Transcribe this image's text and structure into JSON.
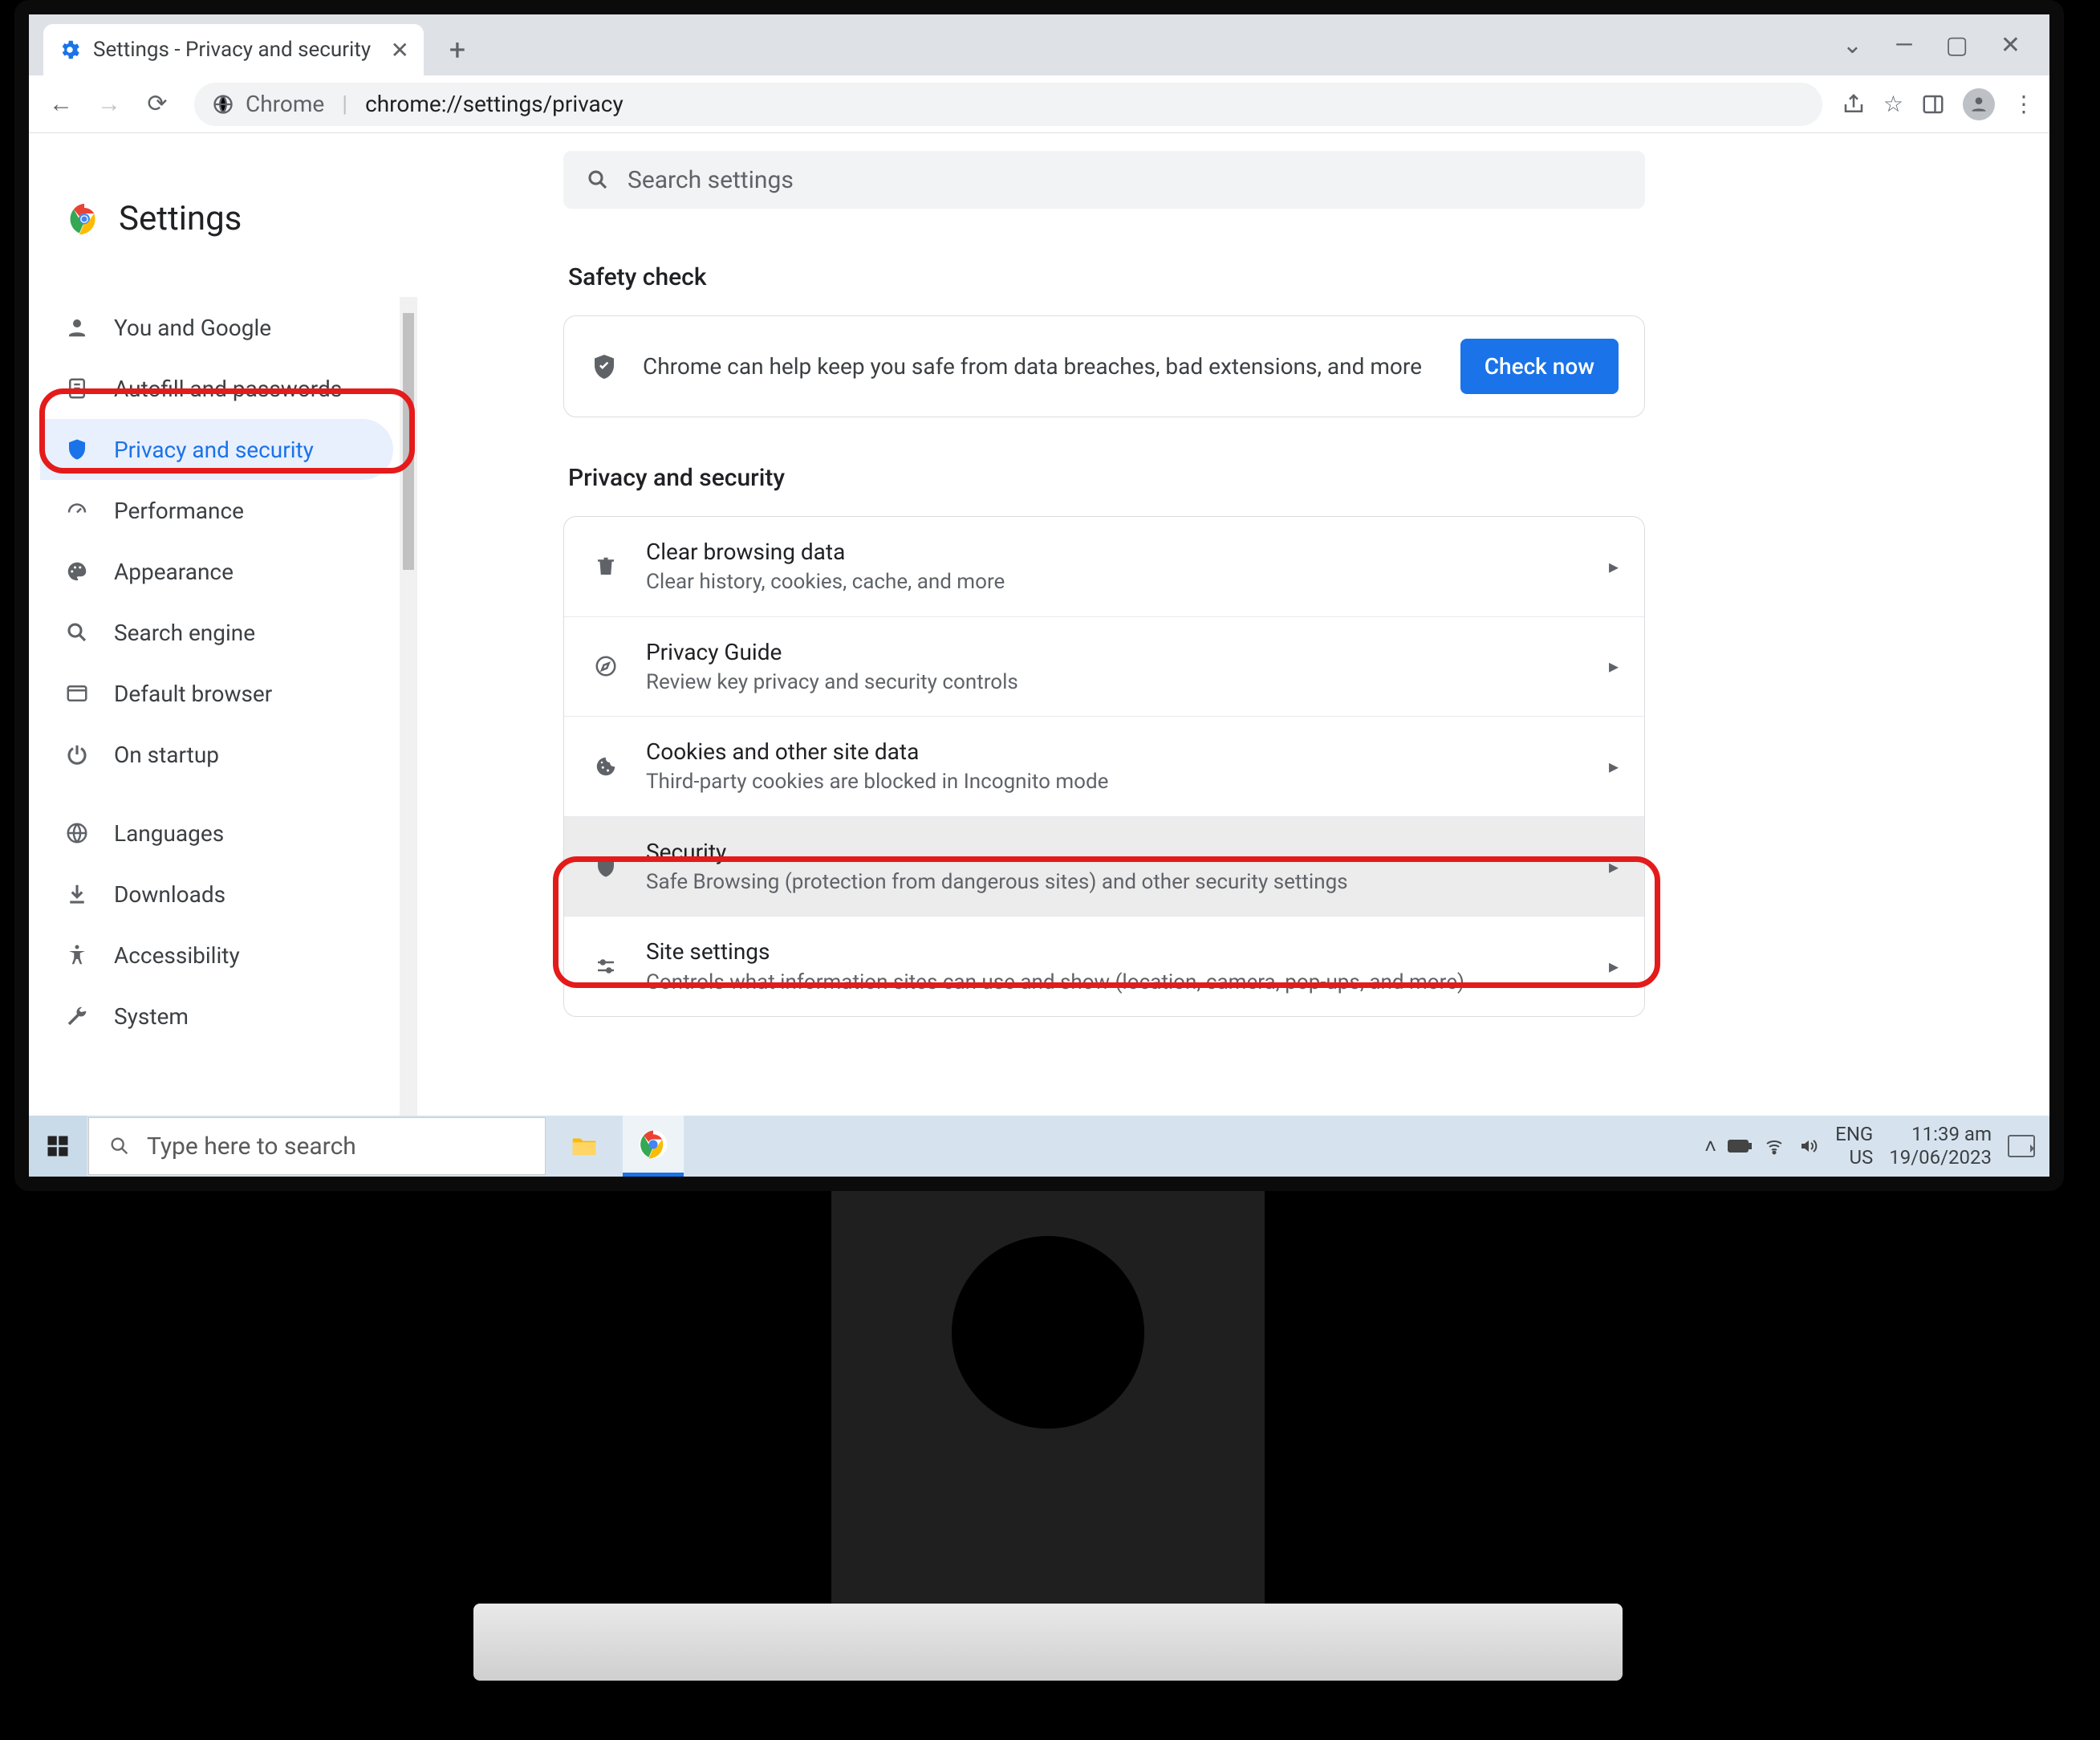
{
  "tab": {
    "title": "Settings - Privacy and security"
  },
  "omnibox": {
    "scheme": "Chrome",
    "url": "chrome://settings/privacy"
  },
  "page": {
    "title": "Settings",
    "search_placeholder": "Search settings"
  },
  "sidebar": {
    "items": [
      {
        "label": "You and Google"
      },
      {
        "label": "Autofill and passwords"
      },
      {
        "label": "Privacy and security"
      },
      {
        "label": "Performance"
      },
      {
        "label": "Appearance"
      },
      {
        "label": "Search engine"
      },
      {
        "label": "Default browser"
      },
      {
        "label": "On startup"
      },
      {
        "label": "Languages"
      },
      {
        "label": "Downloads"
      },
      {
        "label": "Accessibility"
      },
      {
        "label": "System"
      }
    ]
  },
  "safety": {
    "heading": "Safety check",
    "text": "Chrome can help keep you safe from data breaches, bad extensions, and more",
    "button": "Check now"
  },
  "privacy": {
    "heading": "Privacy and security",
    "rows": [
      {
        "title": "Clear browsing data",
        "sub": "Clear history, cookies, cache, and more"
      },
      {
        "title": "Privacy Guide",
        "sub": "Review key privacy and security controls"
      },
      {
        "title": "Cookies and other site data",
        "sub": "Third-party cookies are blocked in Incognito mode"
      },
      {
        "title": "Security",
        "sub": "Safe Browsing (protection from dangerous sites) and other security settings"
      },
      {
        "title": "Site settings",
        "sub": "Controls what information sites can use and show (location, camera, pop-ups, and more)"
      }
    ]
  },
  "taskbar": {
    "search_placeholder": "Type here to search",
    "lang1": "ENG",
    "lang2": "US",
    "time": "11:39 am",
    "date": "19/06/2023"
  }
}
